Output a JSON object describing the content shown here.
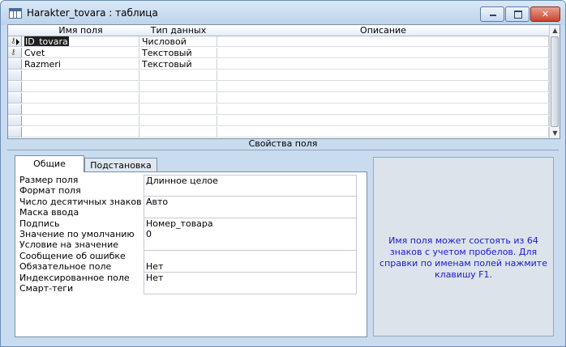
{
  "window": {
    "title": "Harakter_tovara : таблица",
    "minimize_glyph": "",
    "maximize_glyph": "",
    "close_glyph": "✕"
  },
  "grid": {
    "columns": [
      "Имя поля",
      "Тип данных",
      "Описание"
    ],
    "rows": [
      {
        "name": "ID_tovara",
        "type": "Числовой",
        "desc": "",
        "key": true,
        "current": true
      },
      {
        "name": "Cvet",
        "type": "Текстовый",
        "desc": "",
        "key": true,
        "current": false
      },
      {
        "name": "Razmeri",
        "type": "Текстовый",
        "desc": "",
        "key": false,
        "current": false
      },
      {
        "name": "",
        "type": "",
        "desc": "",
        "key": false,
        "current": false
      },
      {
        "name": "",
        "type": "",
        "desc": "",
        "key": false,
        "current": false
      },
      {
        "name": "",
        "type": "",
        "desc": "",
        "key": false,
        "current": false
      },
      {
        "name": "",
        "type": "",
        "desc": "",
        "key": false,
        "current": false
      },
      {
        "name": "",
        "type": "",
        "desc": "",
        "key": false,
        "current": false
      },
      {
        "name": "",
        "type": "",
        "desc": "",
        "key": false,
        "current": false
      },
      {
        "name": "",
        "type": "",
        "desc": "",
        "key": false,
        "current": false
      }
    ]
  },
  "properties": {
    "section_title": "Свойства поля",
    "tabs": [
      "Общие",
      "Подстановка"
    ],
    "items": [
      {
        "label": "Размер поля",
        "value": "Длинное целое"
      },
      {
        "label": "Формат поля",
        "value": ""
      },
      {
        "label": "Число десятичных знаков",
        "value": "Авто"
      },
      {
        "label": "Маска ввода",
        "value": ""
      },
      {
        "label": "Подпись",
        "value": "Номер_товара"
      },
      {
        "label": "Значение по умолчанию",
        "value": "0"
      },
      {
        "label": "Условие на значение",
        "value": ""
      },
      {
        "label": "Сообщение об ошибке",
        "value": ""
      },
      {
        "label": "Обязательное поле",
        "value": "Нет"
      },
      {
        "label": "Индексированное поле",
        "value": "Нет"
      },
      {
        "label": "Смарт-теги",
        "value": ""
      }
    ],
    "help_text": "Имя поля может состоять из 64 знаков с учетом пробелов.  Для справки по именам полей нажмите клавишу F1."
  },
  "colors": {
    "window_bg": "#c9dcef",
    "help_text": "#1a1ad0",
    "selection": "#1f1f1f"
  },
  "icons": {
    "title": "table-icon",
    "key": "primary-key-icon",
    "row_pointer": "current-row-arrow-icon"
  }
}
